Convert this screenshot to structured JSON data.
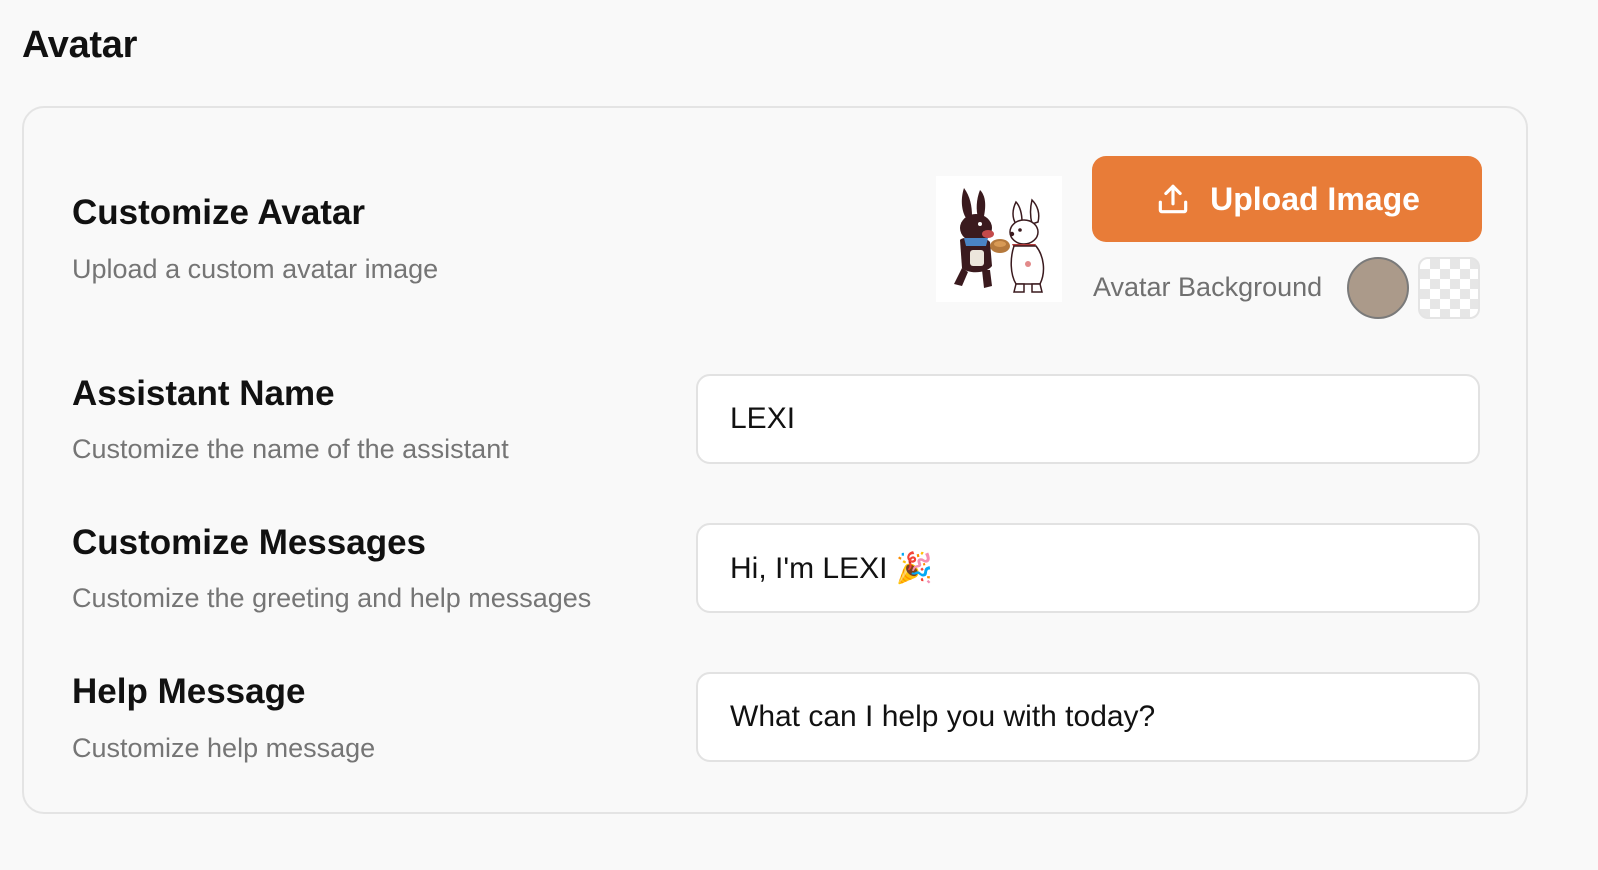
{
  "section": {
    "title": "Avatar"
  },
  "avatar": {
    "label": "Customize Avatar",
    "description": "Upload a custom avatar image",
    "upload_button_label": "Upload Image",
    "upload_icon": "upload-icon",
    "background_label": "Avatar Background",
    "background_color": "#ab9a8a",
    "background_options": [
      "color",
      "transparent"
    ]
  },
  "assistant_name": {
    "label": "Assistant Name",
    "description": "Customize the name of the assistant",
    "value": "LEXI"
  },
  "messages": {
    "label": "Customize Messages",
    "description": "Customize the greeting and help messages",
    "value": "Hi, I'm LEXI 🎉"
  },
  "help_message": {
    "label": "Help Message",
    "description": "Customize help message",
    "value": "What can I help you with today?"
  },
  "colors": {
    "accent": "#e87c38",
    "card_border": "#e4e4e4",
    "muted_text": "#757575"
  }
}
